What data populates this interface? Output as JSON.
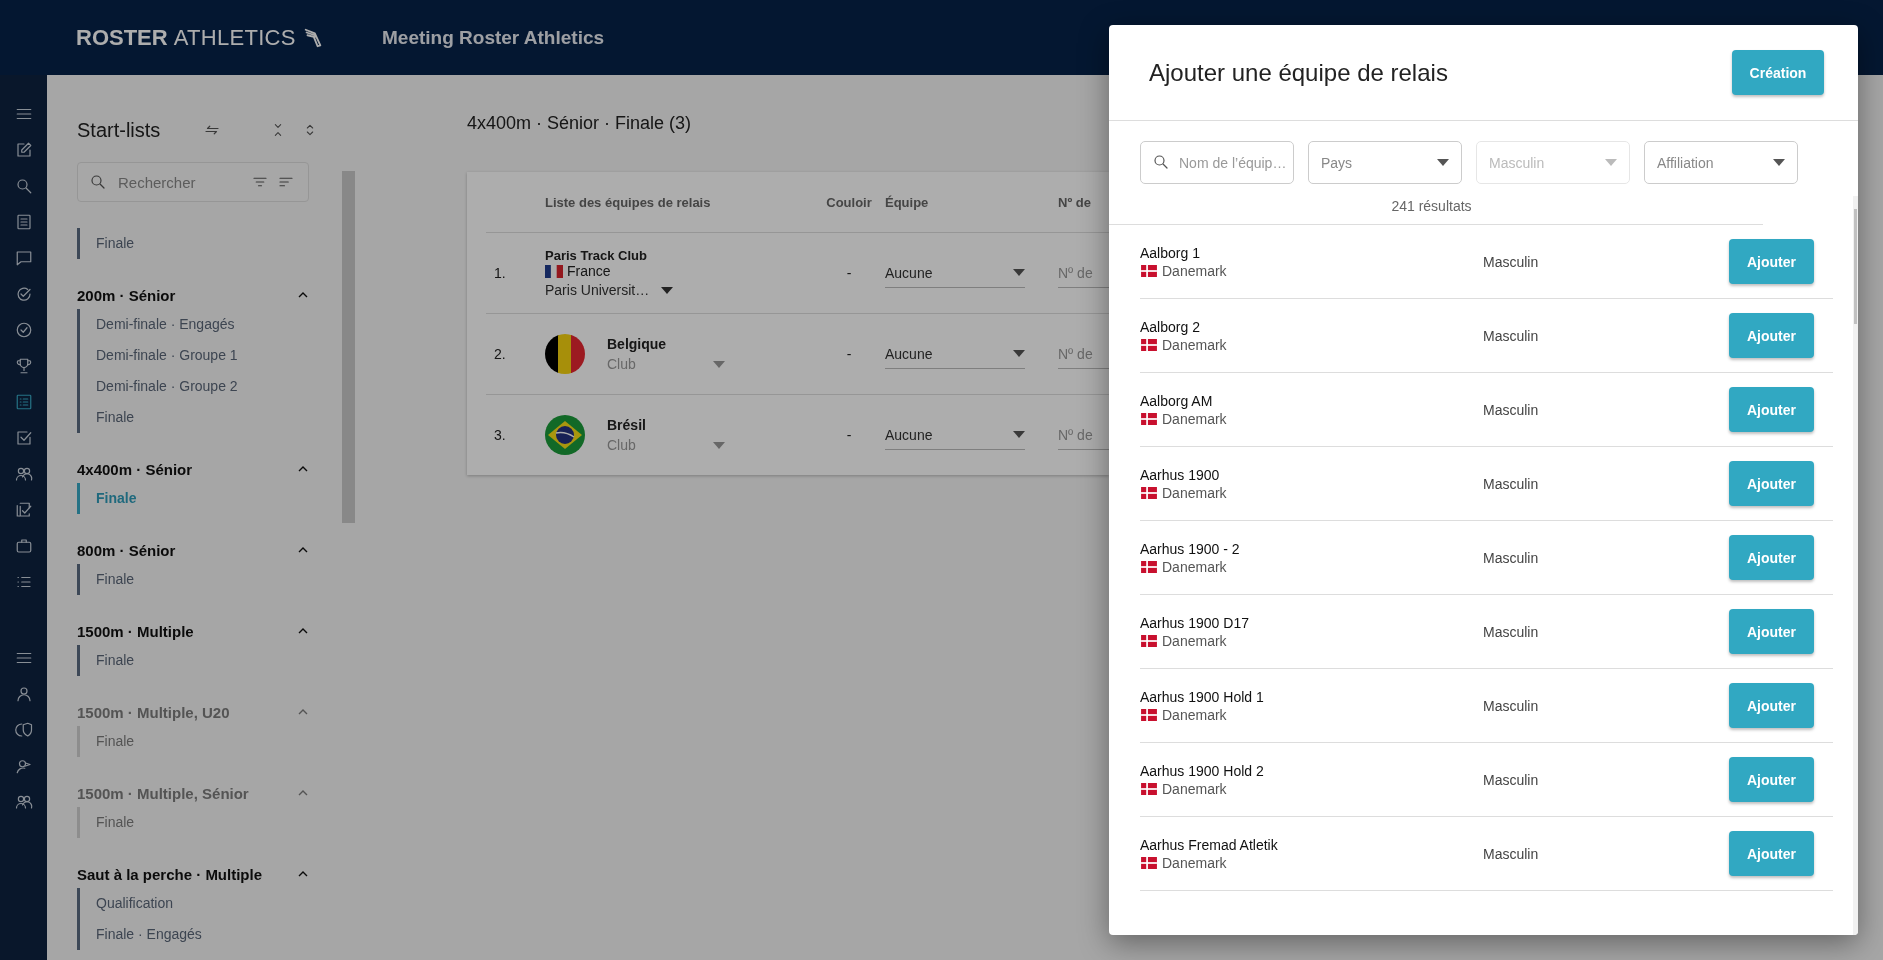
{
  "header": {
    "logo_bold": "ROSTER",
    "logo_light": "ATHLETICS",
    "title": "Meeting Roster Athletics"
  },
  "rail": {
    "top": [
      {
        "selected": false
      },
      {
        "selected": false
      },
      {
        "selected": false
      },
      {
        "selected": false
      },
      {
        "selected": false
      },
      {
        "selected": false
      },
      {
        "selected": false
      },
      {
        "selected": false
      },
      {
        "selected": true
      },
      {
        "selected": false
      },
      {
        "selected": false
      },
      {
        "selected": false
      },
      {
        "selected": false
      },
      {
        "selected": false
      }
    ],
    "bottom": [
      {
        "selected": false
      },
      {
        "selected": false
      },
      {
        "selected": false
      },
      {
        "selected": false
      },
      {
        "selected": false
      }
    ]
  },
  "sidebar": {
    "title": "Start-lists",
    "search_placeholder": "Rechercher",
    "groups": [
      {
        "disabled": false,
        "items": [
          {
            "label": "Finale",
            "selected": false
          }
        ]
      },
      {
        "title": "200m · Sénior",
        "disabled": false,
        "items": [
          {
            "label": "Demi-finale · Engagés",
            "selected": false
          },
          {
            "label": "Demi-finale · Groupe 1",
            "selected": false
          },
          {
            "label": "Demi-finale · Groupe 2",
            "selected": false
          },
          {
            "label": "Finale",
            "selected": false
          }
        ]
      },
      {
        "title": "4x400m · Sénior",
        "disabled": false,
        "items": [
          {
            "label": "Finale",
            "selected": true
          }
        ]
      },
      {
        "title": "800m · Sénior",
        "disabled": false,
        "items": [
          {
            "label": "Finale",
            "selected": false
          }
        ]
      },
      {
        "title": "1500m · Multiple",
        "disabled": false,
        "items": [
          {
            "label": "Finale",
            "selected": false
          }
        ]
      },
      {
        "title": "1500m · Multiple, U20",
        "disabled": true,
        "items": [
          {
            "label": "Finale",
            "selected": false
          }
        ]
      },
      {
        "title": "1500m · Multiple, Sénior",
        "disabled": true,
        "items": [
          {
            "label": "Finale",
            "selected": false
          }
        ]
      },
      {
        "title": "Saut à la perche · Multiple",
        "disabled": false,
        "items": [
          {
            "label": "Qualification",
            "selected": false
          },
          {
            "label": "Finale · Engagés",
            "selected": false
          }
        ]
      }
    ]
  },
  "main": {
    "title": "4x400m · Sénior · Finale (3)",
    "columns": [
      "Liste des équipes de relais",
      "Couloir",
      "Équipe",
      "Nº de"
    ],
    "rows": [
      {
        "number": "1.",
        "kind": "club",
        "flag": {
          "kind": "stripes",
          "parts": [
            {
              "color": "#15285f"
            },
            {
              "color": "#adadad"
            },
            {
              "color": "#93181e"
            }
          ]
        },
        "name": "Paris Track Club",
        "country": "France",
        "affiliation": "Paris Universit…",
        "lane": "-",
        "team": "Aucune",
        "bib_placeholder": "Nº de"
      },
      {
        "number": "2.",
        "kind": "nation",
        "flag": {
          "kind": "stripes",
          "parts": [
            {
              "color": "#000000"
            },
            {
              "color": "#a78f0a"
            },
            {
              "color": "#9c1a21"
            }
          ]
        },
        "name": "Belgique",
        "affiliation_placeholder": "Club",
        "lane": "-",
        "team": "Aucune",
        "bib_placeholder": "Nº de"
      },
      {
        "number": "3.",
        "kind": "nation",
        "flag": {
          "kind": "diamond",
          "parts": [
            {
              "color": "#126927"
            },
            {
              "color": "#a9960f"
            },
            {
              "color": "#182156"
            }
          ]
        },
        "name": "Brésil",
        "affiliation_placeholder": "Club",
        "lane": "-",
        "team": "Aucune",
        "bib_placeholder": "Nº de"
      }
    ]
  },
  "modal": {
    "title": "Ajouter une équipe de relais",
    "create_button": "Création",
    "filters": [
      {
        "kind": "search",
        "placeholder": "Nom de l’équip…",
        "disabled": false
      },
      {
        "kind": "select",
        "placeholder": "Pays",
        "disabled": false
      },
      {
        "kind": "select",
        "placeholder": "Masculin",
        "disabled": true
      },
      {
        "kind": "select",
        "placeholder": "Affiliation",
        "disabled": false
      }
    ],
    "count": "241 résultats",
    "results": [
      {
        "name": "Aalborg 1",
        "country": "Danemark",
        "gender": "Masculin",
        "button": "Ajouter"
      },
      {
        "name": "Aalborg 2",
        "country": "Danemark",
        "gender": "Masculin",
        "button": "Ajouter"
      },
      {
        "name": "Aalborg AM",
        "country": "Danemark",
        "gender": "Masculin",
        "button": "Ajouter"
      },
      {
        "name": "Aarhus 1900",
        "country": "Danemark",
        "gender": "Masculin",
        "button": "Ajouter"
      },
      {
        "name": "Aarhus 1900 - 2",
        "country": "Danemark",
        "gender": "Masculin",
        "button": "Ajouter"
      },
      {
        "name": "Aarhus 1900 D17",
        "country": "Danemark",
        "gender": "Masculin",
        "button": "Ajouter"
      },
      {
        "name": "Aarhus 1900 Hold 1",
        "country": "Danemark",
        "gender": "Masculin",
        "button": "Ajouter"
      },
      {
        "name": "Aarhus 1900 Hold 2",
        "country": "Danemark",
        "gender": "Masculin",
        "button": "Ajouter"
      },
      {
        "name": "Aarhus Fremad Atletik",
        "country": "Danemark",
        "gender": "Masculin",
        "button": "Ajouter"
      }
    ]
  }
}
